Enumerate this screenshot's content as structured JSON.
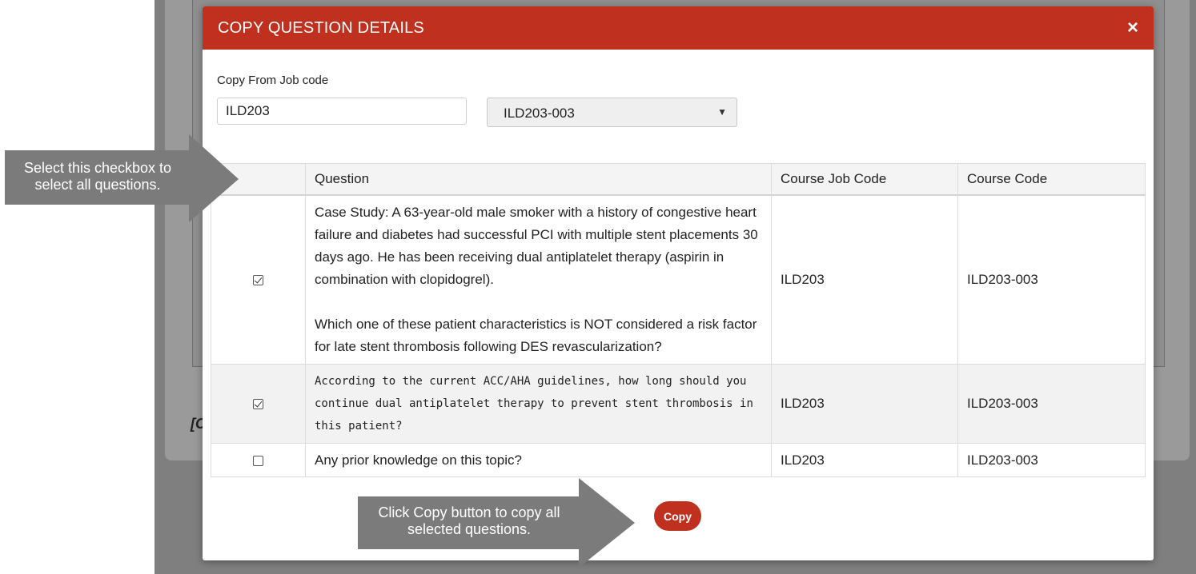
{
  "background": {
    "partial_text": "[C"
  },
  "modal": {
    "title": "COPY QUESTION DETAILS",
    "close_symbol": "×",
    "copy_from_label": "Copy From Job code",
    "job_code_value": "ILD203",
    "course_select_value": "ILD203-003",
    "select_arrow": "▼",
    "table": {
      "headers": {
        "question": "Question",
        "course_job_code": "Course Job Code",
        "course_code": "Course Code"
      },
      "rows": [
        {
          "checked": true,
          "question_p1": "Case Study: A 63-year-old male smoker with a history of congestive heart failure and diabetes had successful PCI with multiple stent placements 30 days ago. He has been receiving dual antiplatelet therapy (aspirin in combination with clopidogrel).",
          "question_p2": "Which one of these patient characteristics is NOT considered a risk factor for late stent thrombosis following DES revascularization?",
          "course_job_code": "ILD203",
          "course_code": "ILD203-003"
        },
        {
          "checked": true,
          "question_p1": "According to the current ACC/AHA guidelines, how long should you continue dual antiplatelet therapy to prevent stent thrombosis in this patient?",
          "course_job_code": "ILD203",
          "course_code": "ILD203-003"
        },
        {
          "checked": false,
          "question_p1": "Any prior knowledge on this topic?",
          "course_job_code": "ILD203",
          "course_code": "ILD203-003"
        }
      ]
    },
    "copy_button": "Copy"
  },
  "callouts": {
    "select_all": "Select this checkbox to select all questions.",
    "copy": "Click Copy button to copy all selected questions."
  },
  "colors": {
    "header_red": "#c0301e",
    "callout_gray": "#7b7b7b",
    "backdrop_gray": "#7f7f7f"
  }
}
